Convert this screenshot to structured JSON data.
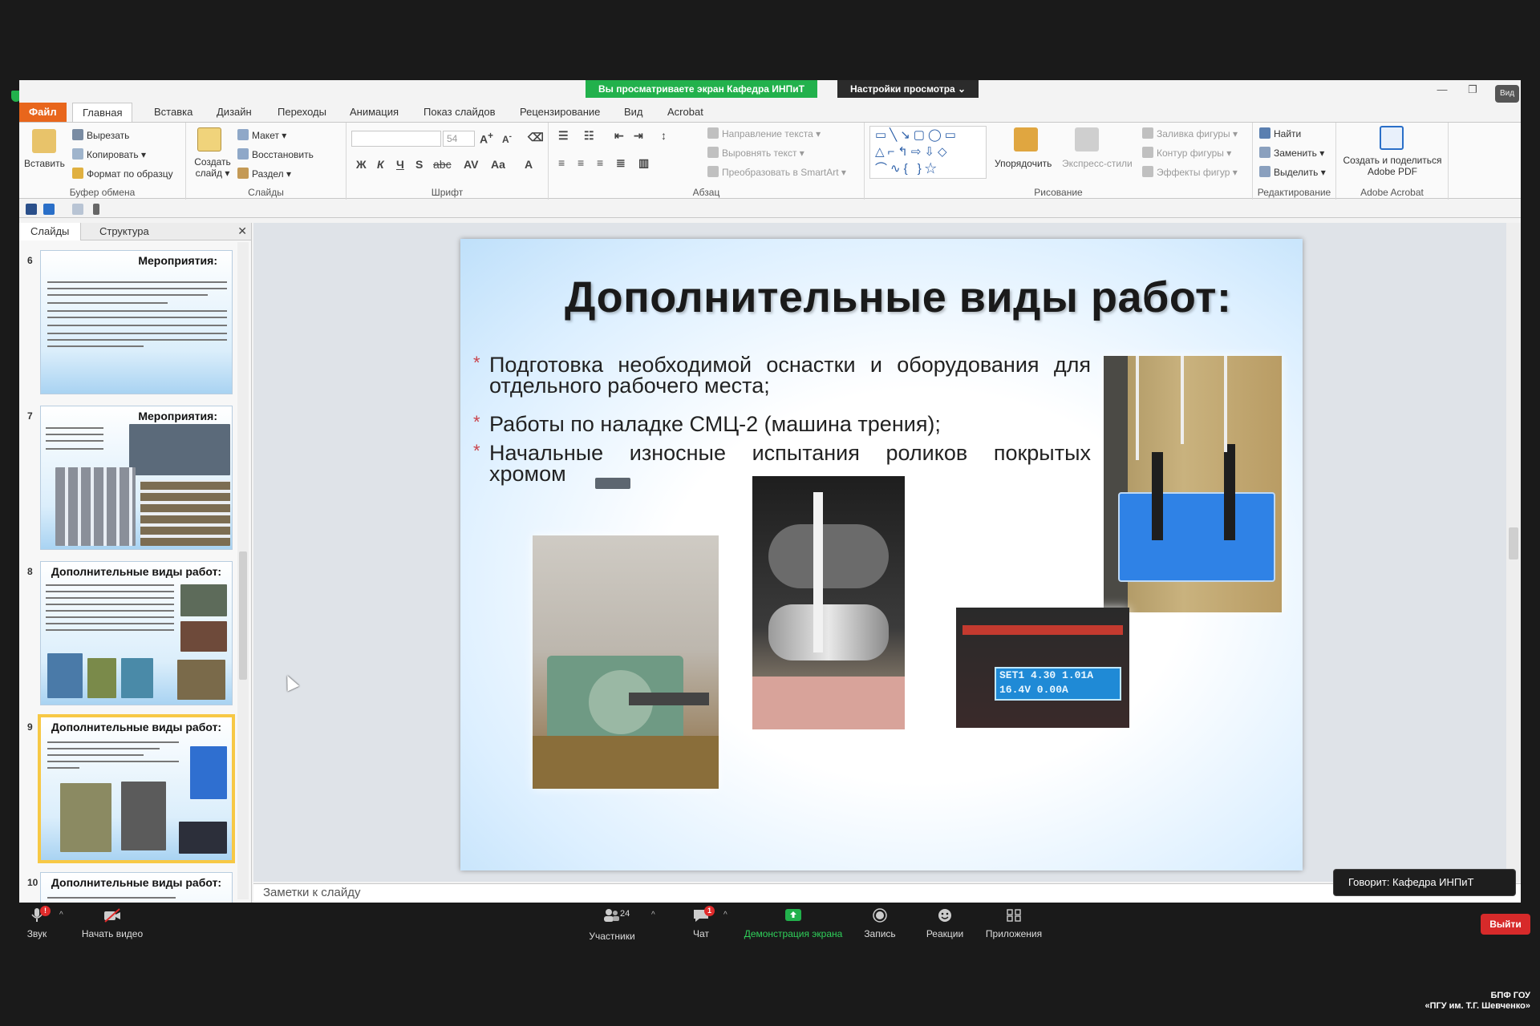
{
  "share": {
    "banner": "Вы просматриваете экран Кафедра ИНПиТ",
    "view_settings": "Настройки просмотра ⌄"
  },
  "window": {
    "view_chip": "Вид"
  },
  "ribbon": {
    "tabs": [
      "Файл",
      "Главная",
      "Вставка",
      "Дизайн",
      "Переходы",
      "Анимация",
      "Показ слайдов",
      "Рецензирование",
      "Вид",
      "Acrobat"
    ],
    "clipboard": {
      "paste": "Вставить",
      "cut": "Вырезать",
      "copy": "Копировать ▾",
      "format": "Формат по образцу",
      "label": "Буфер обмена"
    },
    "slides": {
      "new_slide": "Создать слайд ▾",
      "layout": "Макет ▾",
      "reset": "Восстановить",
      "section": "Раздел ▾",
      "label": "Слайды"
    },
    "font": {
      "size": "54",
      "label": "Шрифт"
    },
    "paragraph": {
      "direction": "Направление текста ▾",
      "align": "Выровнять текст ▾",
      "smartart": "Преобразовать в SmartArt ▾",
      "label": "Абзац"
    },
    "drawing": {
      "arrange": "Упорядочить",
      "quick_styles": "Экспресс-стили",
      "fill": "Заливка фигуры ▾",
      "outline": "Контур фигуры ▾",
      "effects": "Эффекты фигур ▾",
      "label": "Рисование"
    },
    "editing": {
      "find": "Найти",
      "replace": "Заменить ▾",
      "select": "Выделить ▾",
      "label": "Редактирование"
    },
    "acrobat": {
      "create": "Создать и поделиться Adobe PDF",
      "label": "Adobe Acrobat"
    }
  },
  "pane": {
    "tab_slides": "Слайды",
    "tab_outline": "Структура",
    "thumbs": [
      {
        "num": "6",
        "title": "Мероприятия:"
      },
      {
        "num": "7",
        "title": "Мероприятия:"
      },
      {
        "num": "8",
        "title": "Дополнительные виды работ:"
      },
      {
        "num": "9",
        "title": "Дополнительные виды работ:"
      },
      {
        "num": "10",
        "title": "Дополнительные виды работ:"
      }
    ]
  },
  "slide": {
    "title": "Дополнительные виды работ:",
    "bullets": [
      "Подготовка необходимой оснастки и оборудования для отдельного рабочего места;",
      "Работы по наладке СМЦ-2 (машина трения);",
      "Начальные износные испытания роликов покрытых хромом"
    ],
    "display_line1": "SET1  4.30  1.01A",
    "display_line2": "16.4V  0.00A"
  },
  "notes_placeholder": "Заметки к слайду",
  "speaker": "Говорит: Кафедра ИНПиТ",
  "zoom": {
    "audio": "Звук",
    "video": "Начать видео",
    "participants": "Участники",
    "participants_count": "24",
    "chat": "Чат",
    "chat_badge": "1",
    "share": "Демонстрация экрана",
    "record": "Запись",
    "reactions": "Реакции",
    "apps": "Приложения",
    "leave": "Выйти"
  },
  "watermark": {
    "line1": "БПФ ГОУ",
    "line2": "«ПГУ им. Т.Г. Шевченко»"
  },
  "colors": {
    "file_tab": "#e8661c",
    "share_green": "#22b14c",
    "leave_red": "#d72a2a",
    "selected_thumb": "#f7c845"
  }
}
